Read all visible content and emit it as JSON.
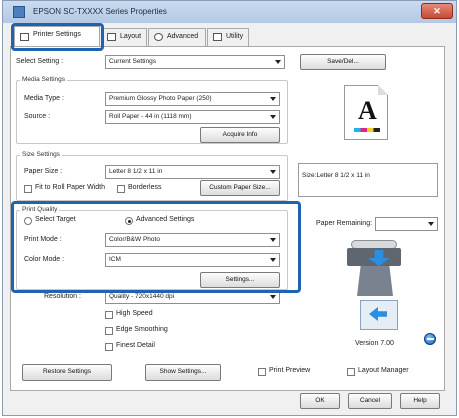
{
  "window": {
    "title": "EPSON SC-TXXXX Series Properties",
    "close_symbol": "✕"
  },
  "tabs": [
    {
      "label": "Printer Settings",
      "icon": "printer-icon"
    },
    {
      "label": "Layout",
      "icon": "page-icon"
    },
    {
      "label": "Advanced",
      "icon": "gear-icon"
    },
    {
      "label": "Utility",
      "icon": "utility-icon"
    }
  ],
  "select_setting": {
    "label": "Select Setting :",
    "value": "Current Settings",
    "save_del_button": "Save/Del..."
  },
  "media_settings": {
    "title": "Media Settings",
    "media_type_label": "Media Type :",
    "media_type_value": "Premium Glossy Photo Paper (250)",
    "source_label": "Source :",
    "source_value": "Roll Paper - 44 in (1118 mm)",
    "acquire_info_button": "Acquire Info"
  },
  "size_settings": {
    "title": "Size Settings",
    "paper_size_label": "Paper Size :",
    "paper_size_value": "Letter 8 1/2 x 11 in",
    "fit_to_roll_label": "Fit to Roll Paper Width",
    "borderless_label": "Borderless",
    "custom_paper_size_button": "Custom Paper Size..."
  },
  "print_quality": {
    "title": "Print Quality",
    "select_target_label": "Select Target",
    "advanced_settings_label": "Advanced Settings",
    "print_mode_label": "Print Mode :",
    "print_mode_value": "Color/B&W Photo",
    "color_mode_label": "Color Mode :",
    "color_mode_value": "ICM",
    "settings_button": "Settings...",
    "resolution_label": "Resolution :",
    "resolution_value": "Quality - 720x1440 dpi",
    "high_speed_label": "High Speed",
    "edge_smoothing_label": "Edge Smoothing",
    "finest_detail_label": "Finest Detail"
  },
  "preview": {
    "paper_letter": "A",
    "size_text": "Size:Letter 8 1/2 x 11 in",
    "paper_remaining_label": "Paper Remaining:",
    "version": "Version 7.00"
  },
  "footer": {
    "restore_settings_button": "Restore Settings",
    "show_settings_button": "Show Settings...",
    "print_preview_label": "Print Preview",
    "layout_manager_label": "Layout Manager"
  },
  "dialog_buttons": {
    "ok": "OK",
    "cancel": "Cancel",
    "help": "Help"
  },
  "colors": {
    "highlight": "#1f64b0",
    "titlebar": "#b3c9e4",
    "accent_blue": "#2a8fe0"
  }
}
